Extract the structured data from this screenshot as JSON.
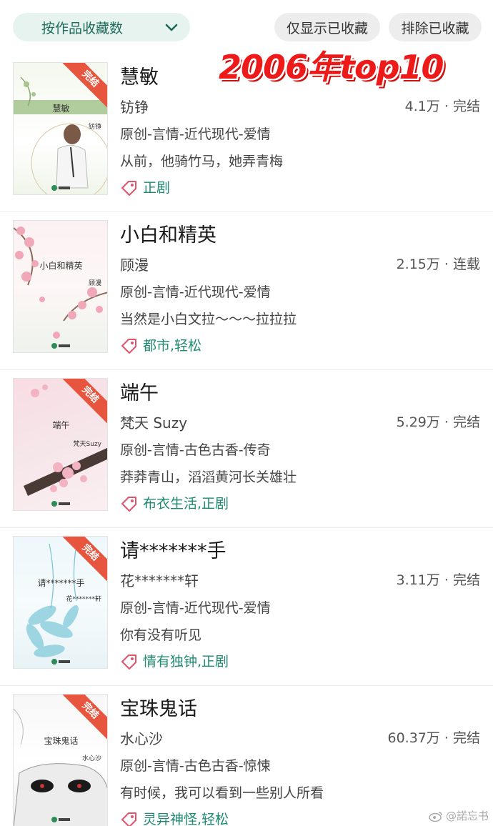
{
  "header": {
    "sort_label": "按作品收藏数",
    "filter_only_label": "仅显示已收藏",
    "filter_exclude_label": "排除已收藏",
    "overlay_title": "2006年top10",
    "overlay_color": "#ee1a1a"
  },
  "books": [
    {
      "title": "慧敏",
      "author": "钫铮",
      "stats": "4.1万 · 完结",
      "category": "原创-言情-近代现代-爱情",
      "desc": "从前，他骑竹马，她弄青梅",
      "tags": "正剧",
      "cover_title": "慧敏",
      "cover_author": "钫铮",
      "cover_ribbon": "完结"
    },
    {
      "title": "小白和精英",
      "author": "顾漫",
      "stats": "2.15万 · 连载",
      "category": "原创-言情-近代现代-爱情",
      "desc": "当然是小白文拉～～～拉拉拉",
      "tags": "都市,轻松",
      "cover_title": "小白和精英",
      "cover_author": "顾漫"
    },
    {
      "title": "端午",
      "author": "梵天 Suzy",
      "stats": "5.29万 · 完结",
      "category": "原创-言情-古色古香-传奇",
      "desc": "莽莽青山，滔滔黄河长关雄壮",
      "tags": "布衣生活,正剧",
      "cover_title": "端午",
      "cover_author": "梵天Suzy",
      "cover_ribbon": "完结"
    },
    {
      "title": "请*******手",
      "author": "花*******轩",
      "stats": "3.11万 · 完结",
      "category": "原创-言情-近代现代-爱情",
      "desc": "你有没有听见",
      "tags": "情有独钟,正剧",
      "cover_title": "请*******手",
      "cover_author": "花*******轩",
      "cover_ribbon": "完结"
    },
    {
      "title": "宝珠鬼话",
      "author": "水心沙",
      "stats": "60.37万 · 完结",
      "category": "原创-言情-古色古香-惊悚",
      "desc": "有时候，我可以看到一些别人所看",
      "tags": "灵异神怪,轻松",
      "cover_title": "宝珠鬼话",
      "cover_author": "水心沙",
      "cover_ribbon": "完结"
    }
  ],
  "watermark": "@諾忘书",
  "colors": {
    "accent": "#1e8a72",
    "ribbon": "#e8553e",
    "tag_icon": "#e2546a"
  }
}
